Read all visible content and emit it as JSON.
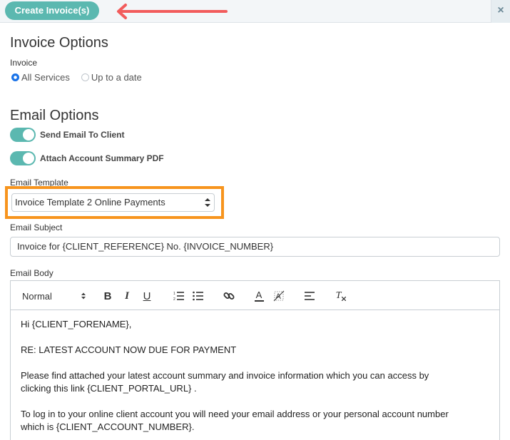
{
  "topbar": {
    "create_button_label": "Create Invoice(s)",
    "close_glyph": "×",
    "arrow_color": "#f25c5c",
    "button_color": "#5bb8b0"
  },
  "invoice_options": {
    "title": "Invoice Options",
    "invoice_label": "Invoice",
    "radio_all_services": "All Services",
    "radio_up_to_date": "Up to a date",
    "selected": "All Services"
  },
  "email_options": {
    "title": "Email Options",
    "toggle_send_email": "Send Email To Client",
    "toggle_attach_pdf": "Attach Account Summary PDF",
    "toggle_send_email_on": true,
    "toggle_attach_pdf_on": true,
    "template_label": "Email Template",
    "template_selected": "Invoice Template 2 Online Payments",
    "highlight_color": "#f7941d",
    "subject_label": "Email Subject",
    "subject_value": "Invoice for {CLIENT_REFERENCE} No. {INVOICE_NUMBER}",
    "body_label": "Email Body"
  },
  "editor": {
    "format_value": "Normal",
    "toolbar_icons": [
      "bold-icon",
      "italic-icon",
      "underline-icon",
      "ordered-list-icon",
      "bullet-list-icon",
      "link-icon",
      "text-color-icon",
      "background-color-icon",
      "align-icon",
      "clear-format-icon"
    ],
    "bold_glyph": "B",
    "italic_glyph": "I",
    "underline_glyph": "U",
    "text_color_glyph": "A",
    "clear_format_glyph": "T",
    "body_lines": [
      "Hi {CLIENT_FORENAME},",
      "RE: LATEST ACCOUNT NOW DUE FOR PAYMENT",
      "Please find attached your latest account summary and invoice information which you can access by clicking this link {CLIENT_PORTAL_URL} .",
      "To log in to your online client account you will need your email address or your personal account number which is {CLIENT_ACCOUNT_NUMBER}."
    ]
  }
}
